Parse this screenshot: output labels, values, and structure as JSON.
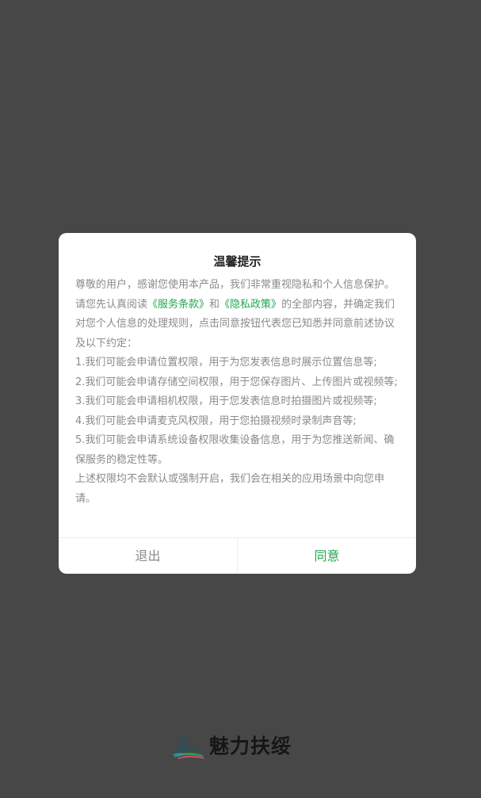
{
  "dialog": {
    "title": "温馨提示",
    "intro_before_terms": "尊敬的用户，感谢您使用本产品，我们非常重视隐私和个人信息保护。请您先认真阅读",
    "terms_link": "《服务条款》",
    "and_text": "和",
    "privacy_link": "《隐私政策》",
    "intro_after_links": "的全部内容，并确定我们对您个人信息的处理规则，点击同意按钮代表您已知悉并同意前述协议及以下约定：",
    "items": [
      "1.我们可能会申请位置权限，用于为您发表信息时展示位置信息等;",
      "2.我们可能会申请存储空间权限，用于您保存图片、上传图片或视频等;",
      "3.我们可能会申请相机权限，用于您发表信息时拍摄图片或视频等;",
      "4.我们可能会申请麦克风权限，用于您拍摄视频时录制声音等;",
      "5.我们可能会申请系统设备权限收集设备信息，用于为您推送新闻、确保服务的稳定性等。"
    ],
    "closing": "上述权限均不会默认或强制开启，我们会在相关的应用场景中向您申请。",
    "exit_label": "退出",
    "agree_label": "同意"
  },
  "brand": {
    "name": "魅力扶绥",
    "logo_icon": "dinosaur-logo-icon"
  },
  "colors": {
    "overlay": "#474747",
    "accent": "#1ea84f",
    "body_text": "#8a8a8a",
    "title_text": "#222222"
  }
}
